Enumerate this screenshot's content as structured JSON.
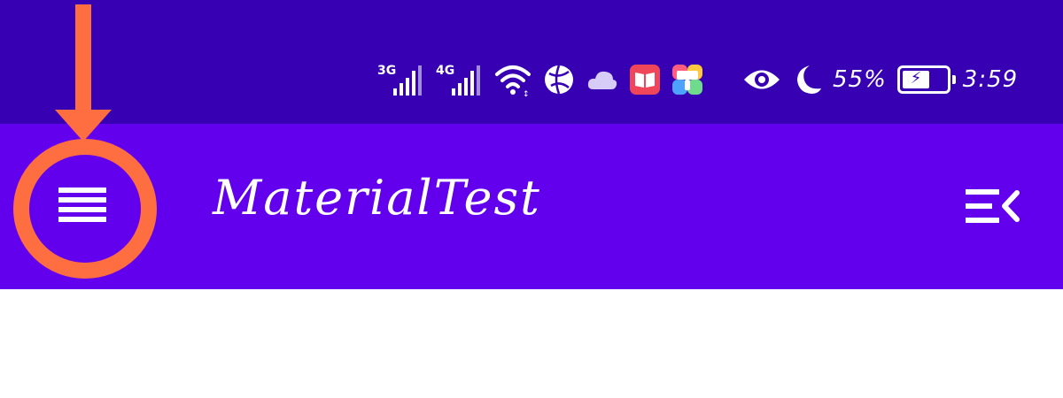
{
  "status_bar": {
    "signal_1_label": "3G",
    "signal_2_label": "4G",
    "battery_percent": "55%",
    "time": "3:59",
    "icons": [
      "signal-3g-icon",
      "signal-4g-icon",
      "wifi-icon",
      "globe-icon",
      "cloud-icon",
      "book-app-icon",
      "paint-app-icon",
      "eye-icon",
      "moon-icon",
      "battery-charging-icon"
    ]
  },
  "toolbar": {
    "title": "MaterialTest",
    "nav_icon": "hamburger-menu-icon",
    "end_icon": "menu-collapse-icon"
  },
  "annotation": {
    "color": "#FF6E40",
    "type": "arrow-and-circle"
  },
  "colors": {
    "status_bar_bg": "#3700B3",
    "toolbar_bg": "#6200EE",
    "content_bg": "#FFFFFF"
  }
}
